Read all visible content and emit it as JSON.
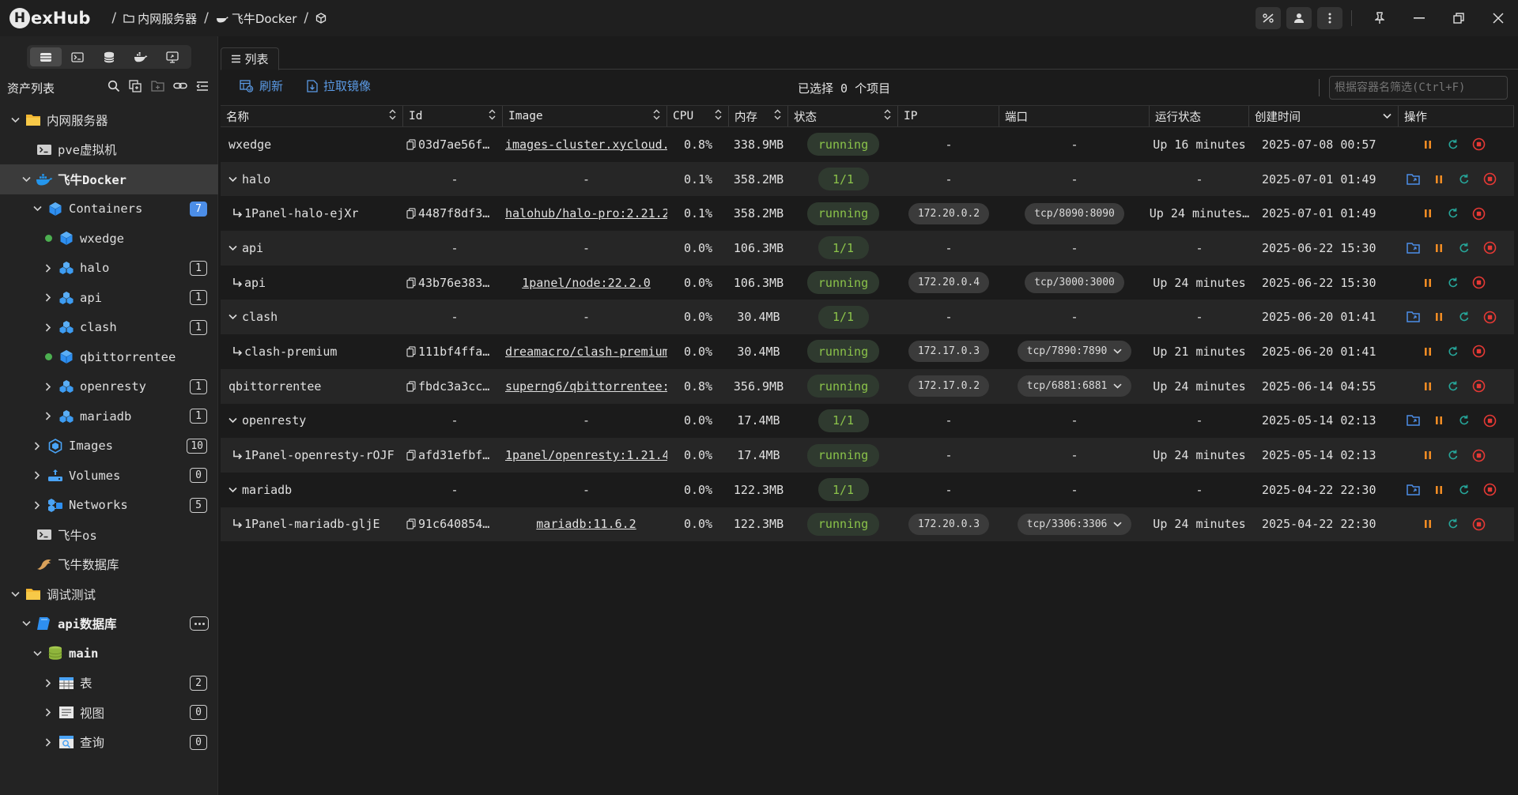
{
  "app": {
    "logo_h": "H",
    "logo_rest": "exHub"
  },
  "breadcrumb": [
    "内网服务器",
    "飞牛Docker"
  ],
  "sidebar": {
    "title": "资产列表",
    "tree": [
      {
        "label": "内网服务器",
        "level": 0,
        "chev": "down",
        "icon": "folder-icon",
        "bold": false
      },
      {
        "label": "pve虚拟机",
        "level": 1,
        "chev": "",
        "icon": "terminal-icon"
      },
      {
        "label": "飞牛Docker",
        "level": 1,
        "chev": "down",
        "icon": "docker-icon",
        "bold": true,
        "selected": true
      },
      {
        "label": "Containers",
        "level": 2,
        "chev": "down",
        "icon": "cube-icon",
        "badge": "7",
        "badge_blue": true
      },
      {
        "label": "wxedge",
        "level": 3,
        "chev": "dot",
        "icon": "cube-icon"
      },
      {
        "label": "halo",
        "level": 3,
        "chev": "right",
        "icon": "cubes-icon",
        "badge": "1"
      },
      {
        "label": "api",
        "level": 3,
        "chev": "right",
        "icon": "cubes-icon",
        "badge": "1"
      },
      {
        "label": "clash",
        "level": 3,
        "chev": "right",
        "icon": "cubes-icon",
        "badge": "1"
      },
      {
        "label": "qbittorrentee",
        "level": 3,
        "chev": "dot",
        "icon": "cube-icon"
      },
      {
        "label": "openresty",
        "level": 3,
        "chev": "right",
        "icon": "cubes-icon",
        "badge": "1"
      },
      {
        "label": "mariadb",
        "level": 3,
        "chev": "right",
        "icon": "cubes-icon",
        "badge": "1"
      },
      {
        "label": "Images",
        "level": 2,
        "chev": "right",
        "icon": "images-icon",
        "badge": "10"
      },
      {
        "label": "Volumes",
        "level": 2,
        "chev": "right",
        "icon": "volumes-icon",
        "badge": "0"
      },
      {
        "label": "Networks",
        "level": 2,
        "chev": "right",
        "icon": "networks-icon",
        "badge": "5"
      },
      {
        "label": "飞牛os",
        "level": 1,
        "chev": "",
        "icon": "terminal-icon"
      },
      {
        "label": "飞牛数据库",
        "level": 1,
        "chev": "",
        "icon": "dolphin-icon"
      },
      {
        "label": "调试测试",
        "level": 0,
        "chev": "down",
        "icon": "folder-icon"
      },
      {
        "label": "api数据库",
        "level": 1,
        "chev": "down",
        "icon": "db-blue-icon",
        "bold": true,
        "dots": true
      },
      {
        "label": "main",
        "level": 2,
        "chev": "down",
        "icon": "db-green-icon",
        "bold": true
      },
      {
        "label": "表",
        "level": 3,
        "chev": "right",
        "icon": "table-icon",
        "badge": "2"
      },
      {
        "label": "视图",
        "level": 3,
        "chev": "right",
        "icon": "view-icon",
        "badge": "0"
      },
      {
        "label": "查询",
        "level": 3,
        "chev": "right",
        "icon": "query-icon",
        "badge": "0"
      }
    ]
  },
  "tab": {
    "label": "列表"
  },
  "toolbar": {
    "refresh": "刷新",
    "pull": "拉取镜像",
    "selected": "已选择 0 个项目",
    "search_placeholder": "根据容器名筛选(Ctrl+F)"
  },
  "table": {
    "headers": [
      "名称",
      "Id",
      "Image",
      "CPU",
      "内存",
      "状态",
      "IP",
      "端口",
      "运行状态",
      "创建时间",
      "操作"
    ],
    "rows": [
      {
        "kind": "container",
        "name": "wxedge",
        "id": "03d7ae56f…",
        "image": "images-cluster.xycloud.",
        "cpu": "0.8%",
        "mem": "338.9MB",
        "state": "running",
        "ip": "-",
        "port": "-",
        "run": "Up 16 minutes",
        "created": "2025-07-08 00:57"
      },
      {
        "kind": "group",
        "name": "halo",
        "id": "-",
        "image": "-",
        "cpu": "0.1%",
        "mem": "358.2MB",
        "state": "1/1",
        "ip": "-",
        "port": "-",
        "run": "-",
        "created": "2025-07-01 01:49"
      },
      {
        "kind": "child",
        "name": "1Panel-halo-ejXr",
        "id": "4487f8df3…",
        "image": "halohub/halo-pro:2.21.2",
        "cpu": "0.1%",
        "mem": "358.2MB",
        "state": "running",
        "ip": "172.20.0.2",
        "port": "tcp/8090:8090",
        "run": "Up 24 minutes…",
        "created": "2025-07-01 01:49"
      },
      {
        "kind": "group",
        "name": "api",
        "id": "-",
        "image": "-",
        "cpu": "0.0%",
        "mem": "106.3MB",
        "state": "1/1",
        "ip": "-",
        "port": "-",
        "run": "-",
        "created": "2025-06-22 15:30"
      },
      {
        "kind": "child",
        "name": "api",
        "id": "43b76e383…",
        "image": "1panel/node:22.2.0",
        "cpu": "0.0%",
        "mem": "106.3MB",
        "state": "running",
        "ip": "172.20.0.4",
        "port": "tcp/3000:3000",
        "run": "Up 24 minutes",
        "created": "2025-06-22 15:30"
      },
      {
        "kind": "group",
        "name": "clash",
        "id": "-",
        "image": "-",
        "cpu": "0.0%",
        "mem": "30.4MB",
        "state": "1/1",
        "ip": "-",
        "port": "-",
        "run": "-",
        "created": "2025-06-20 01:41"
      },
      {
        "kind": "child",
        "name": "clash-premium",
        "id": "111bf4ffa…",
        "image": "dreamacro/clash-premium",
        "cpu": "0.0%",
        "mem": "30.4MB",
        "state": "running",
        "ip": "172.17.0.3",
        "port": "tcp/7890:7890",
        "port_dd": true,
        "run": "Up 21 minutes",
        "created": "2025-06-20 01:41"
      },
      {
        "kind": "container",
        "name": "qbittorrentee",
        "id": "fbdc3a3cc…",
        "image": "superng6/qbittorrentee:",
        "cpu": "0.8%",
        "mem": "356.9MB",
        "state": "running",
        "ip": "172.17.0.2",
        "port": "tcp/6881:6881",
        "port_dd": true,
        "run": "Up 24 minutes",
        "created": "2025-06-14 04:55"
      },
      {
        "kind": "group",
        "name": "openresty",
        "id": "-",
        "image": "-",
        "cpu": "0.0%",
        "mem": "17.4MB",
        "state": "1/1",
        "ip": "-",
        "port": "-",
        "run": "-",
        "created": "2025-05-14 02:13"
      },
      {
        "kind": "child",
        "name": "1Panel-openresty-rOJF",
        "id": "afd31efbf…",
        "image": "1panel/openresty:1.21.4",
        "cpu": "0.0%",
        "mem": "17.4MB",
        "state": "running",
        "ip": "-",
        "port": "-",
        "run": "Up 24 minutes",
        "created": "2025-05-14 02:13"
      },
      {
        "kind": "group",
        "name": "mariadb",
        "id": "-",
        "image": "-",
        "cpu": "0.0%",
        "mem": "122.3MB",
        "state": "1/1",
        "ip": "-",
        "port": "-",
        "run": "-",
        "created": "2025-04-22 22:30"
      },
      {
        "kind": "child",
        "name": "1Panel-mariadb-gljE",
        "id": "91c640854…",
        "image": "mariadb:11.6.2",
        "cpu": "0.0%",
        "mem": "122.3MB",
        "state": "running",
        "ip": "172.20.0.3",
        "port": "tcp/3306:3306",
        "port_dd": true,
        "run": "Up 24 minutes",
        "created": "2025-04-22 22:30"
      }
    ]
  },
  "colors": {
    "accent": "#4c8ee8",
    "running_text": "#8bc34a",
    "pause": "#f08c24",
    "restart": "#26a69a",
    "stop": "#e53935"
  }
}
